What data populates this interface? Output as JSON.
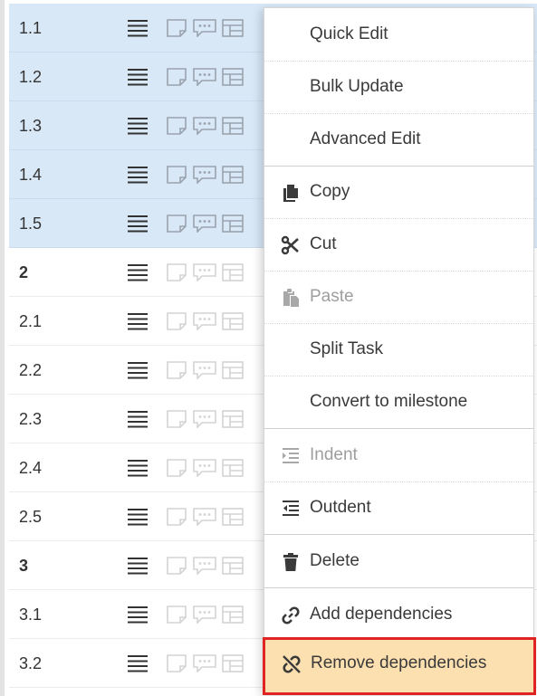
{
  "rows": [
    {
      "num": "1.1",
      "selected": true,
      "bold": false
    },
    {
      "num": "1.2",
      "selected": true,
      "bold": false
    },
    {
      "num": "1.3",
      "selected": true,
      "bold": false
    },
    {
      "num": "1.4",
      "selected": true,
      "bold": false
    },
    {
      "num": "1.5",
      "selected": true,
      "bold": false
    },
    {
      "num": "2",
      "selected": false,
      "bold": true
    },
    {
      "num": "2.1",
      "selected": false,
      "bold": false
    },
    {
      "num": "2.2",
      "selected": false,
      "bold": false
    },
    {
      "num": "2.3",
      "selected": false,
      "bold": false
    },
    {
      "num": "2.4",
      "selected": false,
      "bold": false
    },
    {
      "num": "2.5",
      "selected": false,
      "bold": false
    },
    {
      "num": "3",
      "selected": false,
      "bold": true
    },
    {
      "num": "3.1",
      "selected": false,
      "bold": false
    },
    {
      "num": "3.2",
      "selected": false,
      "bold": false
    }
  ],
  "menu": {
    "quick_edit": "Quick Edit",
    "bulk_update": "Bulk Update",
    "advanced_edit": "Advanced Edit",
    "copy": "Copy",
    "cut": "Cut",
    "paste": "Paste",
    "split_task": "Split Task",
    "convert_milestone": "Convert to milestone",
    "indent": "Indent",
    "outdent": "Outdent",
    "delete": "Delete",
    "add_dependencies": "Add dependencies",
    "remove_dependencies": "Remove dependencies"
  },
  "colors": {
    "selected_row": "#d9e8f7",
    "highlight_fill": "#fde0b0",
    "highlight_border": "#e02424",
    "disabled_text": "#9e9e9e"
  },
  "icons": {
    "row_menu": "hamburger-icon",
    "row_note": "note-icon",
    "row_comment": "comment-icon",
    "row_layout": "layout-icon",
    "copy": "copy-icon",
    "cut": "scissors-icon",
    "paste": "paste-icon",
    "indent": "indent-icon",
    "outdent": "outdent-icon",
    "delete": "trash-icon",
    "add_dependencies": "link-icon",
    "remove_dependencies": "unlink-icon"
  }
}
